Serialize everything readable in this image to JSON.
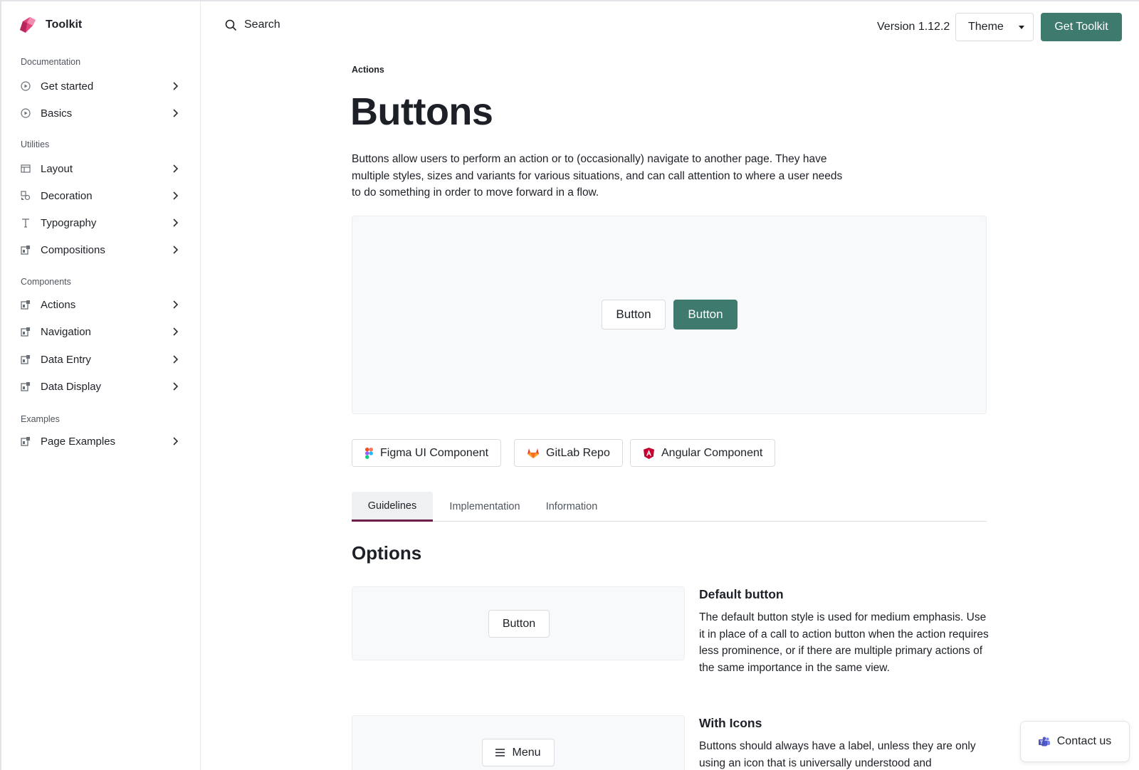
{
  "brand": {
    "name": "Toolkit"
  },
  "sidebar": {
    "sections": [
      {
        "title": "Documentation",
        "items": [
          {
            "label": "Get started",
            "icon": "play-circle-icon"
          },
          {
            "label": "Basics",
            "icon": "play-circle-icon"
          }
        ]
      },
      {
        "title": "Utilities",
        "items": [
          {
            "label": "Layout",
            "icon": "layout-icon"
          },
          {
            "label": "Decoration",
            "icon": "decoration-icon"
          },
          {
            "label": "Typography",
            "icon": "typography-icon"
          },
          {
            "label": "Compositions",
            "icon": "component-icon"
          }
        ]
      },
      {
        "title": "Components",
        "items": [
          {
            "label": "Actions",
            "icon": "component-icon"
          },
          {
            "label": "Navigation",
            "icon": "component-icon"
          },
          {
            "label": "Data Entry",
            "icon": "component-icon"
          },
          {
            "label": "Data Display",
            "icon": "component-icon"
          }
        ]
      },
      {
        "title": "Examples",
        "items": [
          {
            "label": "Page Examples",
            "icon": "component-icon"
          }
        ]
      }
    ]
  },
  "header": {
    "search_label": "Search",
    "version": "Version 1.12.2",
    "theme_label": "Theme",
    "cta_label": "Get Toolkit"
  },
  "page": {
    "eyebrow": "Actions",
    "title": "Buttons",
    "intro": "Buttons allow users to perform an action or to (occasionally) navigate to another page. They have multiple styles, sizes and variants for various situations, and can call attention to where a user needs to do something in order to move forward in a flow.",
    "demo": {
      "default_label": "Button",
      "primary_label": "Button"
    },
    "links": [
      {
        "label": "Figma UI Component",
        "icon": "figma-icon"
      },
      {
        "label": "GitLab Repo",
        "icon": "gitlab-icon"
      },
      {
        "label": "Angular Component",
        "icon": "angular-icon"
      }
    ],
    "tabs": [
      {
        "label": "Guidelines",
        "active": true
      },
      {
        "label": "Implementation",
        "active": false
      },
      {
        "label": "Information",
        "active": false
      }
    ],
    "options_title": "Options",
    "options": [
      {
        "example_label": "Button",
        "title": "Default button",
        "description": "The default button style is used for medium emphasis. Use it in place of a call to action button when the action requires less prominence, or if there are multiple primary actions of the same importance in the same view."
      },
      {
        "example_label": "Menu",
        "example_icon": "menu-icon",
        "title": "With Icons",
        "description": "Buttons should always have a label, unless they are only using an icon that is universally understood and"
      }
    ]
  },
  "contact": {
    "label": "Contact us",
    "icon": "teams-icon"
  },
  "colors": {
    "accent": "#3e7a6e",
    "tab_indicator": "#6b1f4a",
    "demo_bg": "#f8f9fa"
  }
}
